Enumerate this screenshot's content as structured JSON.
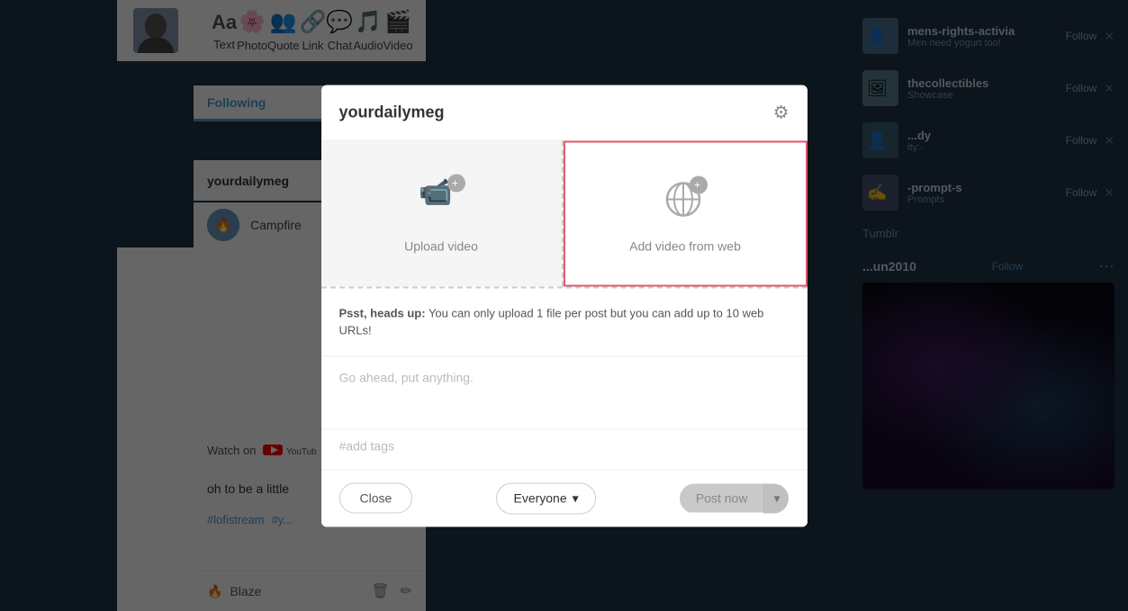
{
  "toolbar": {
    "items": [
      {
        "id": "text",
        "label": "Text",
        "icon": "Aa"
      },
      {
        "id": "photo",
        "label": "Photo",
        "icon": "🌸"
      },
      {
        "id": "quote",
        "label": "Quote",
        "icon": "👥"
      },
      {
        "id": "link",
        "label": "Link",
        "icon": "🔗"
      },
      {
        "id": "chat",
        "label": "Chat",
        "icon": "💬"
      },
      {
        "id": "audio",
        "label": "Audio",
        "icon": "🎵"
      },
      {
        "id": "video",
        "label": "Video",
        "icon": "🎬"
      }
    ]
  },
  "modal": {
    "username": "yourdailymeg",
    "gear_icon": "⚙",
    "upload_video_label": "Upload video",
    "add_from_web_label": "Add video from web",
    "info_bold": "Psst, heads up:",
    "info_text": " You can only upload 1 file per post but you can add up to 10 web URLs!",
    "content_placeholder": "Go ahead, put anything.",
    "tags_placeholder": "#add tags",
    "close_label": "Close",
    "audience_label": "Everyone",
    "post_label": "Post now",
    "chevron": "▾",
    "post_arrow": "▾"
  },
  "follow_bar": {
    "label": "Following"
  },
  "username_row": {
    "name": "yourdailymeg"
  },
  "campfire": {
    "text": "Campfire"
  },
  "watch": {
    "text": "Watch on"
  },
  "oh_row": {
    "text": "oh to be a little"
  },
  "tags": {
    "tag1": "#lofistream",
    "tag2": "#y..."
  },
  "blaze": {
    "label": "Blaze"
  },
  "right_sidebar": {
    "items": [
      {
        "name": "mens-rights-activia",
        "desc": "Men need yogurt too!",
        "follow": "Follow"
      },
      {
        "name": "thecollectibles",
        "desc": "Showcase",
        "follow": "Follow"
      },
      {
        "name": "...dy",
        "desc": "ity:-",
        "follow": "Follow"
      },
      {
        "name": "-prompt-s",
        "desc": "Prompts",
        "follow": "Follow"
      },
      {
        "name": "Tumblr",
        "desc": "",
        "follow": ""
      }
    ]
  },
  "jun_card": {
    "name": "...un2010",
    "follow": "Follow",
    "dots": "···"
  }
}
